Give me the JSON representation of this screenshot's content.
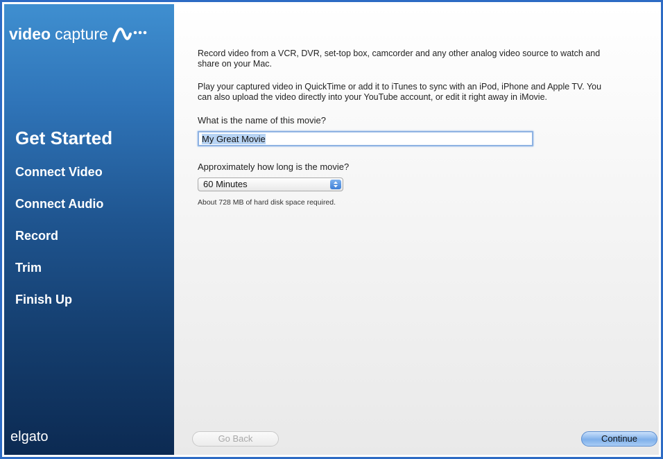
{
  "app": {
    "brand_bold": "video",
    "brand_light": "capture",
    "vendor": "elgato"
  },
  "sidebar": {
    "steps": [
      {
        "label": "Get Started",
        "active": true
      },
      {
        "label": "Connect Video",
        "active": false
      },
      {
        "label": "Connect Audio",
        "active": false
      },
      {
        "label": "Record",
        "active": false
      },
      {
        "label": "Trim",
        "active": false
      },
      {
        "label": "Finish Up",
        "active": false
      }
    ]
  },
  "main": {
    "intro_1": "Record video from a VCR, DVR, set-top box, camcorder and any other analog video source to watch and share on your Mac.",
    "intro_2": "Play your captured video in QuickTime or add it to iTunes to sync with an iPod, iPhone and Apple TV. You can also upload the video directly into your YouTube account, or edit it right away in iMovie.",
    "name_label": "What is the name of this movie?",
    "name_value": "My Great Movie",
    "length_label": "Approximately how long is the movie?",
    "length_selected": "60 Minutes",
    "disk_hint": "About 728 MB of hard disk space required."
  },
  "buttons": {
    "back": "Go Back",
    "continue": "Continue"
  },
  "colors": {
    "accent": "#2d6bc4",
    "sidebar_top": "#3f8fd0",
    "sidebar_bottom": "#0c2a52"
  }
}
